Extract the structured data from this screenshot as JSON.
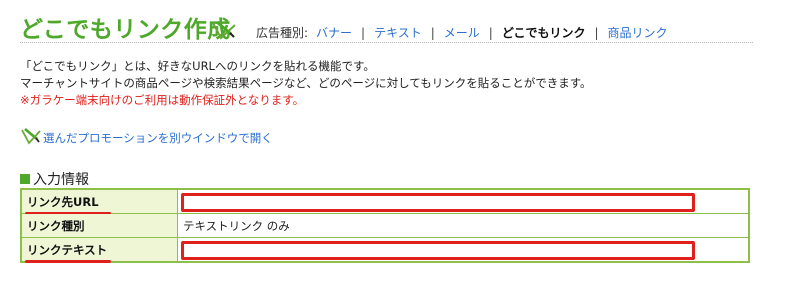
{
  "header": {
    "title": "どこでもリンク作成",
    "ad_type_label": "広告種別:",
    "links": [
      {
        "label": "バナー",
        "current": false
      },
      {
        "label": "テキスト",
        "current": false
      },
      {
        "label": "メール",
        "current": false
      },
      {
        "label": "どこでもリンク",
        "current": true
      },
      {
        "label": "商品リンク",
        "current": false
      }
    ],
    "separator": "|"
  },
  "description": {
    "line1": "「どこでもリンク」とは、好きなURLへのリンクを貼れる機能です。",
    "line2": "マーチャントサイトの商品ページや検索結果ページなど、どのページに対してもリンクを貼ることができます。",
    "warning": "※ガラケー端末向けのご利用は動作保証外となります。"
  },
  "promo_link": "選んだプロモーションを別ウインドウで開く",
  "section": {
    "title": "入力情報"
  },
  "form": {
    "rows": [
      {
        "label": "リンク先URL",
        "value": ""
      },
      {
        "label": "リンク種別",
        "value": "テキストリンク のみ"
      },
      {
        "label": "リンクテキスト",
        "value": ""
      }
    ]
  },
  "colors": {
    "accent_green": "#4ea82a",
    "link_blue": "#2a6fd1",
    "warning_red": "#e0201c",
    "table_border": "#8cc04a",
    "label_bg": "#eef6d6"
  },
  "icons": {
    "title_icon": "pencil-note-icon",
    "promo_icon": "pencil-note-icon"
  }
}
